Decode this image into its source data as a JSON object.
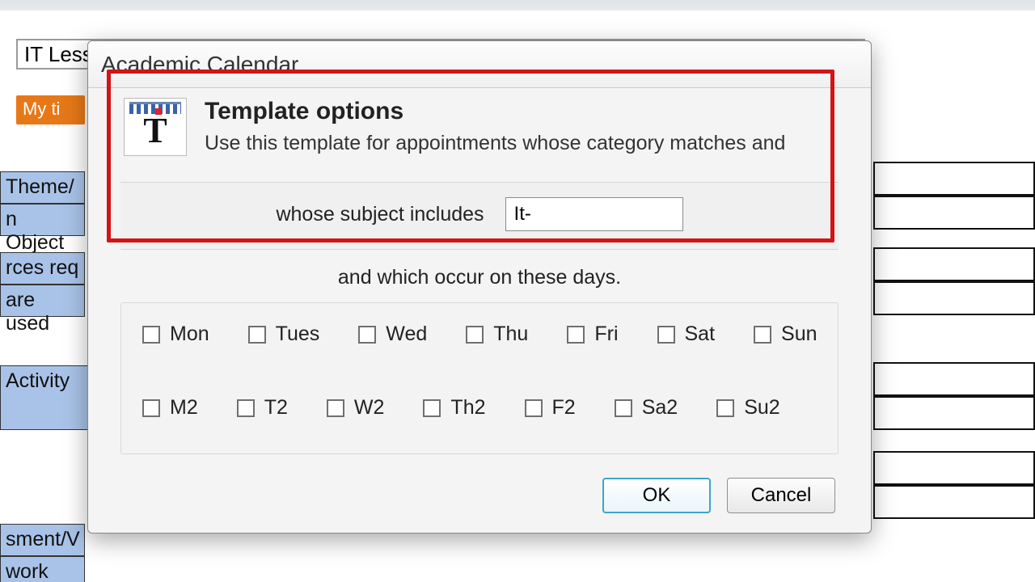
{
  "background": {
    "search_value": "IT Less",
    "tab_label": "My ti",
    "left_labels": [
      "Theme/",
      "n Object",
      "rces req",
      "are used",
      "Activity",
      "sment/V",
      "work"
    ]
  },
  "dialog": {
    "window_title": "Academic Calendar",
    "close_label": "✕",
    "header_title": "Template options",
    "header_desc": "Use this template for appointments whose category matches and",
    "subject_label": "whose subject includes",
    "subject_value": "It-",
    "days_caption": "and which occur on these days.",
    "days_row1": [
      "Mon",
      "Tues",
      "Wed",
      "Thu",
      "Fri",
      "Sat",
      "Sun"
    ],
    "days_row2": [
      "M2",
      "T2",
      "W2",
      "Th2",
      "F2",
      "Sa2",
      "Su2"
    ],
    "ok_label": "OK",
    "cancel_label": "Cancel"
  }
}
